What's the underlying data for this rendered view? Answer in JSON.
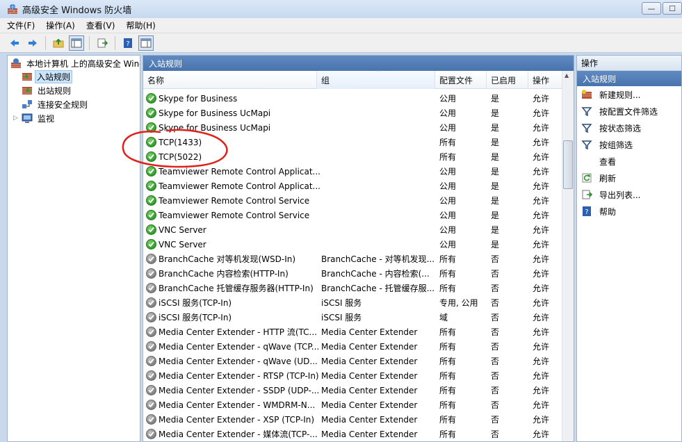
{
  "window": {
    "title": "高级安全 Windows 防火墙",
    "min": "—",
    "max": "☐"
  },
  "menu": [
    "文件(F)",
    "操作(A)",
    "查看(V)",
    "帮助(H)"
  ],
  "tree": [
    {
      "label": "本地计算机 上的高级安全 Windows 防火墙",
      "icon": "firewall-icon"
    },
    {
      "label": "入站规则",
      "icon": "inbound-rules-icon"
    },
    {
      "label": "出站规则",
      "icon": "outbound-rules-icon"
    },
    {
      "label": "连接安全规则",
      "icon": "connection-security-icon"
    },
    {
      "label": "监视",
      "icon": "monitor-icon"
    }
  ],
  "center": {
    "header": "入站规则",
    "columns": {
      "name": "名称",
      "group": "组",
      "profile": "配置文件",
      "enabled": "已启用",
      "action": "操作"
    },
    "rows": [
      {
        "name": "Skype for Business",
        "group": "",
        "profile": "公用",
        "enabled": "是",
        "action": "允许",
        "on": true
      },
      {
        "name": "Skype for Business UcMapi",
        "group": "",
        "profile": "公用",
        "enabled": "是",
        "action": "允许",
        "on": true
      },
      {
        "name": "Skype for Business UcMapi",
        "group": "",
        "profile": "公用",
        "enabled": "是",
        "action": "允许",
        "on": true
      },
      {
        "name": "TCP(1433)",
        "group": "",
        "profile": "所有",
        "enabled": "是",
        "action": "允许",
        "on": true
      },
      {
        "name": "TCP(5022)",
        "group": "",
        "profile": "所有",
        "enabled": "是",
        "action": "允许",
        "on": true
      },
      {
        "name": "Teamviewer Remote Control Applicat...",
        "group": "",
        "profile": "公用",
        "enabled": "是",
        "action": "允许",
        "on": true
      },
      {
        "name": "Teamviewer Remote Control Applicat...",
        "group": "",
        "profile": "公用",
        "enabled": "是",
        "action": "允许",
        "on": true
      },
      {
        "name": "Teamviewer Remote Control Service",
        "group": "",
        "profile": "公用",
        "enabled": "是",
        "action": "允许",
        "on": true
      },
      {
        "name": "Teamviewer Remote Control Service",
        "group": "",
        "profile": "公用",
        "enabled": "是",
        "action": "允许",
        "on": true
      },
      {
        "name": "VNC Server",
        "group": "",
        "profile": "公用",
        "enabled": "是",
        "action": "允许",
        "on": true
      },
      {
        "name": "VNC Server",
        "group": "",
        "profile": "公用",
        "enabled": "是",
        "action": "允许",
        "on": true
      },
      {
        "name": "BranchCache 对等机发现(WSD-In)",
        "group": "BranchCache - 对等机发现...",
        "profile": "所有",
        "enabled": "否",
        "action": "允许",
        "on": false
      },
      {
        "name": "BranchCache 内容检索(HTTP-In)",
        "group": "BranchCache - 内容检索(...",
        "profile": "所有",
        "enabled": "否",
        "action": "允许",
        "on": false
      },
      {
        "name": "BranchCache 托管缓存服务器(HTTP-In)",
        "group": "BranchCache - 托管缓存服...",
        "profile": "所有",
        "enabled": "否",
        "action": "允许",
        "on": false
      },
      {
        "name": "iSCSI 服务(TCP-In)",
        "group": "iSCSI 服务",
        "profile": "专用, 公用",
        "enabled": "否",
        "action": "允许",
        "on": false
      },
      {
        "name": "iSCSI 服务(TCP-In)",
        "group": "iSCSI 服务",
        "profile": "域",
        "enabled": "否",
        "action": "允许",
        "on": false
      },
      {
        "name": "Media Center Extender - HTTP 流(TC...",
        "group": "Media Center Extender",
        "profile": "所有",
        "enabled": "否",
        "action": "允许",
        "on": false
      },
      {
        "name": "Media Center Extender - qWave (TCP...",
        "group": "Media Center Extender",
        "profile": "所有",
        "enabled": "否",
        "action": "允许",
        "on": false
      },
      {
        "name": "Media Center Extender - qWave (UD...",
        "group": "Media Center Extender",
        "profile": "所有",
        "enabled": "否",
        "action": "允许",
        "on": false
      },
      {
        "name": "Media Center Extender - RTSP (TCP-In)",
        "group": "Media Center Extender",
        "profile": "所有",
        "enabled": "否",
        "action": "允许",
        "on": false
      },
      {
        "name": "Media Center Extender - SSDP (UDP-...",
        "group": "Media Center Extender",
        "profile": "所有",
        "enabled": "否",
        "action": "允许",
        "on": false
      },
      {
        "name": "Media Center Extender - WMDRM-N...",
        "group": "Media Center Extender",
        "profile": "所有",
        "enabled": "否",
        "action": "允许",
        "on": false
      },
      {
        "name": "Media Center Extender - XSP (TCP-In)",
        "group": "Media Center Extender",
        "profile": "所有",
        "enabled": "否",
        "action": "允许",
        "on": false
      },
      {
        "name": "Media Center Extender - 媒体流(TCP-...",
        "group": "Media Center Extender",
        "profile": "所有",
        "enabled": "否",
        "action": "允许",
        "on": false
      }
    ]
  },
  "actions": {
    "header": "操作",
    "section": "入站规则",
    "items": [
      {
        "label": "新建规则...",
        "icon": "new-rule-icon"
      },
      {
        "label": "按配置文件筛选",
        "icon": "filter-icon"
      },
      {
        "label": "按状态筛选",
        "icon": "filter-icon"
      },
      {
        "label": "按组筛选",
        "icon": "filter-icon"
      },
      {
        "label": "查看",
        "icon": ""
      },
      {
        "label": "刷新",
        "icon": "refresh-icon"
      },
      {
        "label": "导出列表...",
        "icon": "export-icon"
      },
      {
        "label": "帮助",
        "icon": "help-icon"
      }
    ]
  },
  "colors": {
    "accent": "#4a74ad",
    "annotation": "#e0201b"
  }
}
